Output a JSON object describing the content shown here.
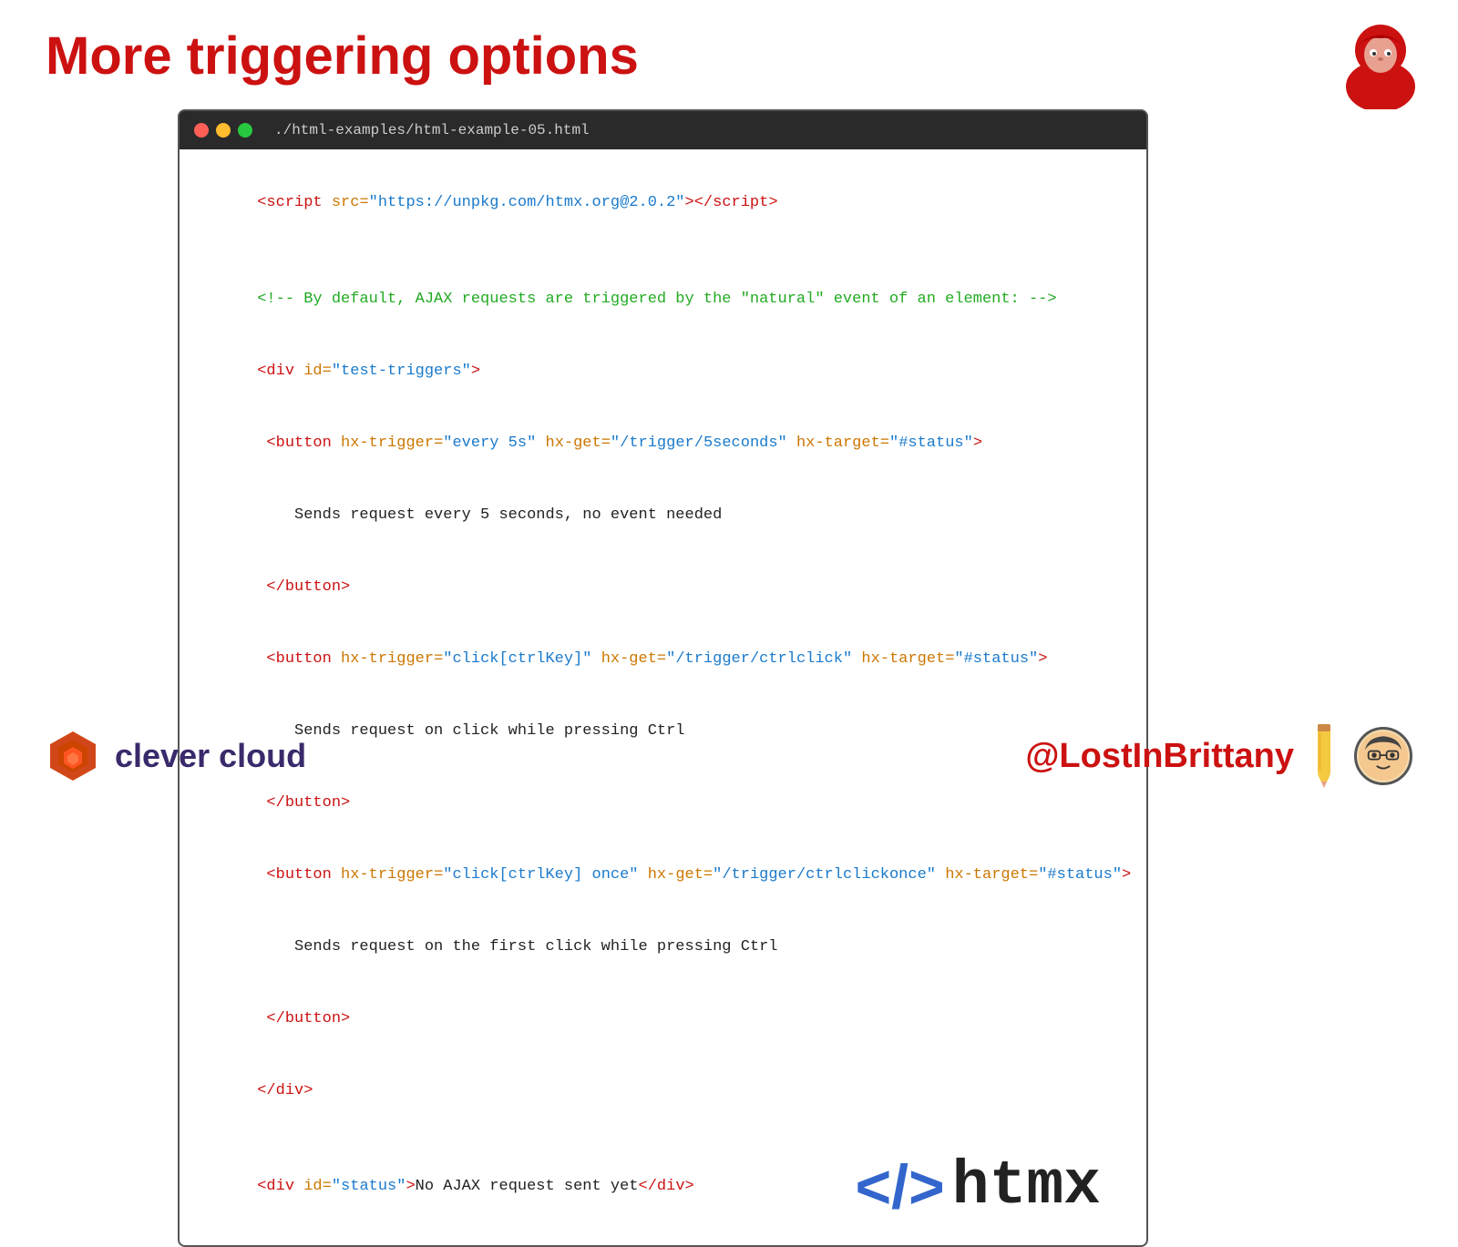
{
  "page": {
    "title": "More triggering options",
    "title_color": "#cc1111"
  },
  "window": {
    "path": "./html-examples/html-example-05.html"
  },
  "code": {
    "line1": "<script src=\"https://unpkg.com/htmx.org@2.0.2\"></script>",
    "comment1": "<!-- By default, AJAX requests are triggered by the \"natural\" event of an element: -->",
    "line2_open": "<div id=\"test-triggers\">",
    "line3": " <button hx-trigger=\"every 5s\" hx-get=\"/trigger/5seconds\" hx-target=\"#status\">",
    "line3_text": "   Sends request every 5 seconds, no event needed",
    "line3_close": " </button>",
    "line4": " <button hx-trigger=\"click[ctrlKey]\" hx-get=\"/trigger/ctrlclick\" hx-target=\"#status\">",
    "line4_text": "   Sends request on click while pressing Ctrl",
    "line4_close": " </button>",
    "line5": " <button hx-trigger=\"click[ctrlKey] once\" hx-get=\"/trigger/ctrlclickonce\" hx-target=\"#status\">",
    "line5_text": "   Sends request on the first click while pressing Ctrl",
    "line5_close": " </button>",
    "line6_close": "</div>",
    "line7": "<div id=\"status\">No AJAX request sent yet</div>"
  },
  "htmx_logo": {
    "brackets": "</> ",
    "text": "htmx"
  },
  "clever_cloud": {
    "text": "clever cloud"
  },
  "social": {
    "handle": "@LostInBrittany"
  }
}
